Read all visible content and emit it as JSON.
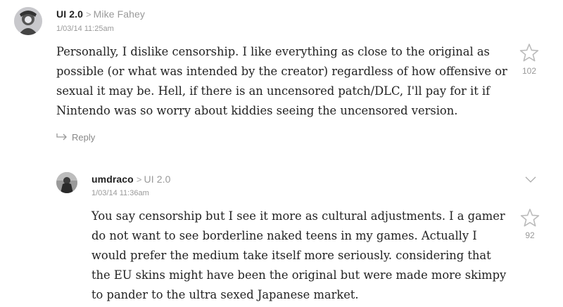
{
  "comments": [
    {
      "author": "UI 2.0",
      "reply_to": "Mike Fahey",
      "timestamp": "1/03/14 11:25am",
      "body": "Personally, I dislike censorship. I like everything as close to the original as possible (or what was intended by the creator) regardless of how offensive or sexual it may be. Hell, if there is an uncensored patch/DLC, I'll pay for it if Nintendo was so worry about kiddies seeing the uncensored version.",
      "star_count": "102",
      "reply_label": "Reply"
    },
    {
      "author": "umdraco",
      "reply_to": "UI 2.0",
      "timestamp": "1/03/14 11:36am",
      "body": "You say censorship but I see it more as cultural adjustments. I a gamer do not want to see borderline naked teens in my games. Actually I would prefer the medium take itself more seriously. considering that the EU skins might have been the original but were made more skimpy to pander to the ultra sexed Japanese market.",
      "star_count": "92"
    }
  ],
  "colors": {
    "text": "#222222",
    "muted": "#999999",
    "star_outline": "#bbbbbb"
  },
  "icons": [
    "avatar",
    "chevron-right-icon",
    "star-icon",
    "reply-arrow-icon",
    "chevron-down-icon"
  ]
}
